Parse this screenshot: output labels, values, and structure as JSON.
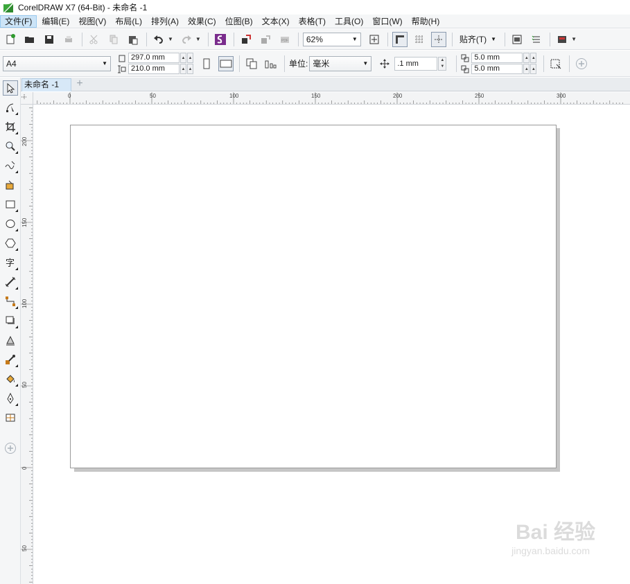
{
  "window": {
    "title": "CorelDRAW X7 (64-Bit) - 未命名 -1"
  },
  "menu": {
    "items": [
      "文件(F)",
      "编辑(E)",
      "视图(V)",
      "布局(L)",
      "排列(A)",
      "效果(C)",
      "位图(B)",
      "文本(X)",
      "表格(T)",
      "工具(O)",
      "窗口(W)",
      "帮助(H)"
    ],
    "active_index": 0
  },
  "toolbar": {
    "zoom_value": "62%",
    "snap_label": "贴齐(T)"
  },
  "property_bar": {
    "paper_size": "A4",
    "width": "297.0 mm",
    "height": "210.0 mm",
    "unit_label": "单位:",
    "unit_value": "毫米",
    "nudge": ".1 mm",
    "dup_x": "5.0 mm",
    "dup_y": "5.0 mm"
  },
  "document": {
    "tab_label": "未命名 -1",
    "add_tab": "+"
  },
  "rulers": {
    "horizontal_labels": [
      "0",
      "50",
      "100",
      "150",
      "200",
      "250",
      "300"
    ],
    "vertical_labels": [
      "200",
      "150",
      "100",
      "50",
      "0",
      "50"
    ]
  },
  "watermark": {
    "brand": "Bai  经验",
    "url": "jingyan.baidu.com"
  },
  "colors": {
    "chrome": "#f5f6f7",
    "active_menu": "#cce4f7",
    "page_shadow": "#c6c6c6",
    "logo_green": "#3aa63a"
  }
}
